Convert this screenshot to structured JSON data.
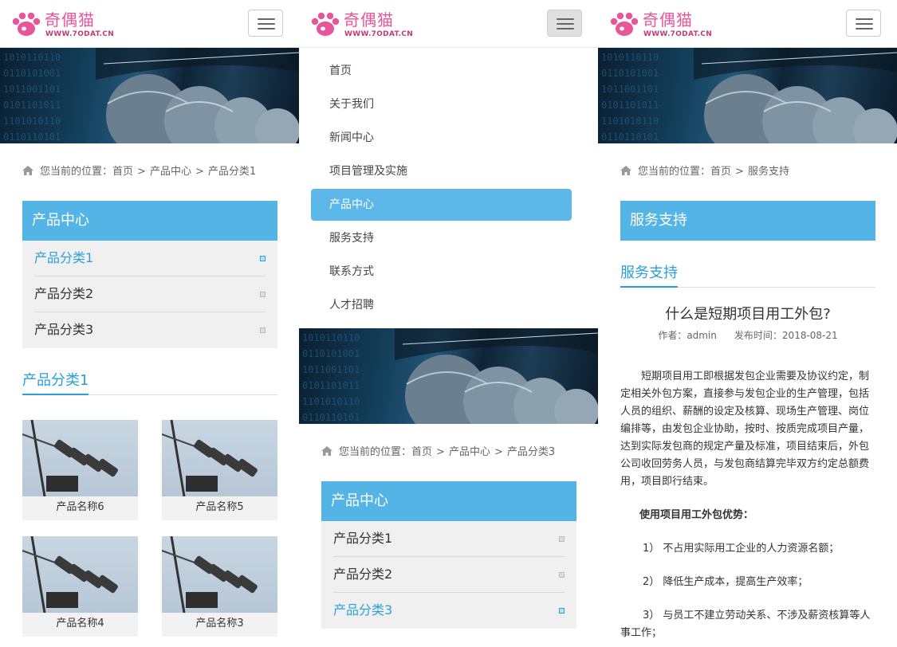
{
  "brand": {
    "name_cn": "奇偶猫",
    "url": "WWW.7ODAT.CN",
    "accent": "#55b4e6",
    "logo_pink": "#e8559a"
  },
  "breadcrumb_prefix": "您当前的位置：",
  "breadcrumb_sep": ">",
  "panel1": {
    "breadcrumb": [
      "首页",
      "产品中心",
      "产品分类1"
    ],
    "category": {
      "title": "产品中心",
      "items": [
        "产品分类1",
        "产品分类2",
        "产品分类3"
      ],
      "active_index": 0
    },
    "section_title": "产品分类1",
    "products": [
      {
        "name": "产品名称6"
      },
      {
        "name": "产品名称5"
      },
      {
        "name": "产品名称4"
      },
      {
        "name": "产品名称3"
      }
    ]
  },
  "panel2": {
    "nav": [
      "首页",
      "关于我们",
      "新闻中心",
      "项目管理及实施",
      "产品中心",
      "服务支持",
      "联系方式",
      "人才招聘"
    ],
    "nav_active_index": 4,
    "breadcrumb": [
      "首页",
      "产品中心",
      "产品分类3"
    ],
    "category": {
      "title": "产品中心",
      "items": [
        "产品分类1",
        "产品分类2",
        "产品分类3"
      ],
      "active_index": 2
    }
  },
  "panel3": {
    "breadcrumb": [
      "首页",
      "服务支持"
    ],
    "category_title": "服务支持",
    "section_title": "服务支持",
    "article": {
      "title": "什么是短期项目用工外包?",
      "author_label": "作者：admin",
      "date_label": "发布时间：2018-08-21",
      "paragraph": "短期项目用工即根据发包企业需要及协议约定，制定相关外包方案，直接参与发包企业的生产管理，包括人员的组织、薪酬的设定及核算、现场生产管理、岗位编排等，由发包企业协助，按时、按质完成项目产量，达到实际发包商的规定产量及标准，项目结束后，外包公司收回劳务人员，与发包商结算完毕双方约定总额费用，项目即行结束。",
      "advantages_title": "使用项目用工外包优势：",
      "advantages": [
        "1） 不占用实际用工企业的人力资源名额；",
        "2） 降低生产成本，提高生产效率；",
        "3） 与员工不建立劳动关系、不涉及薪资核算等人事工作；"
      ]
    }
  }
}
